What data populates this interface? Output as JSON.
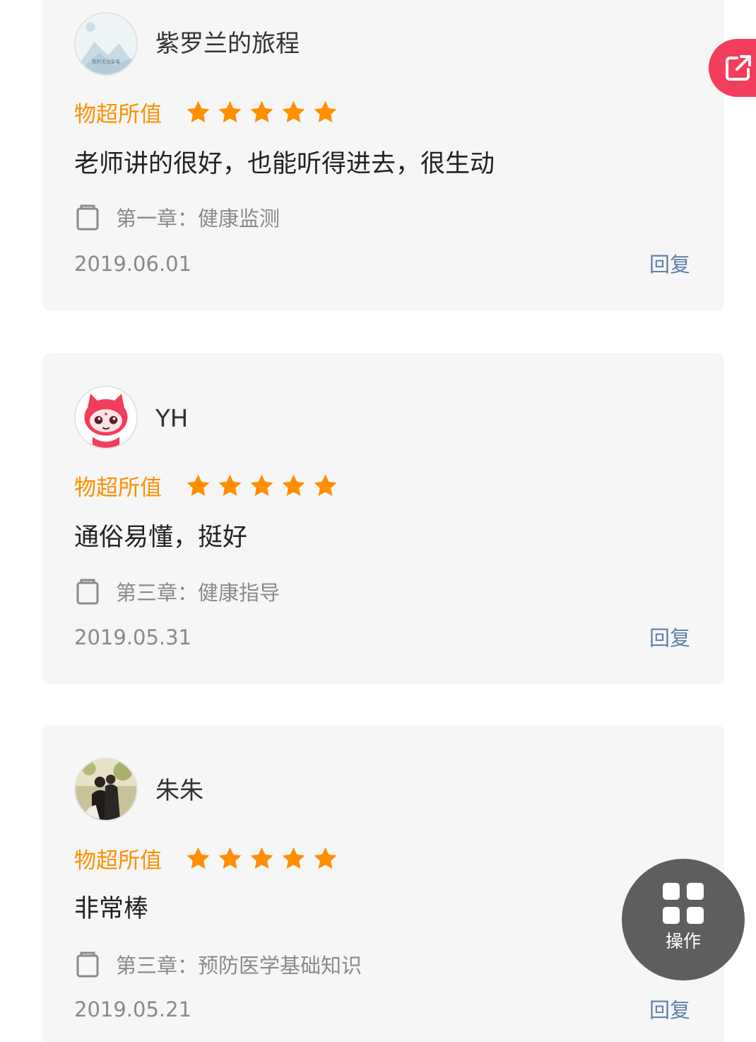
{
  "reviews": [
    {
      "username": "紫罗兰的旅程",
      "avatar_icon": "landscape-placeholder-avatar",
      "avatar_caption": "暂时无法查看",
      "rating_label": "物超所值",
      "rating": 5,
      "comment": "老师讲的很好，也能听得进去，很生动",
      "chapter": "第一章：健康监测",
      "date": "2019.06.01",
      "reply_label": "回复"
    },
    {
      "username": "YH",
      "avatar_icon": "red-cartoon-cat-avatar",
      "rating_label": "物超所值",
      "rating": 5,
      "comment": "通俗易懂，挺好",
      "chapter": "第三章：健康指导",
      "date": "2019.05.31",
      "reply_label": "回复"
    },
    {
      "username": "朱朱",
      "avatar_icon": "couple-photo-avatar",
      "rating_label": "物超所值",
      "rating": 5,
      "comment": "非常棒",
      "chapter": "第三章：预防医学基础知识",
      "date": "2019.05.21",
      "reply_label": "回复"
    }
  ],
  "share_button": {
    "icon": "share-external-icon",
    "color": "#f23d5c"
  },
  "operations_button": {
    "label": "操作",
    "icon": "grid-four-squares-icon"
  },
  "colors": {
    "rating_label": "#ff8f00",
    "star": "#ff8f00",
    "reply": "#5f7fa8",
    "card_bg": "#f6f6f6"
  }
}
